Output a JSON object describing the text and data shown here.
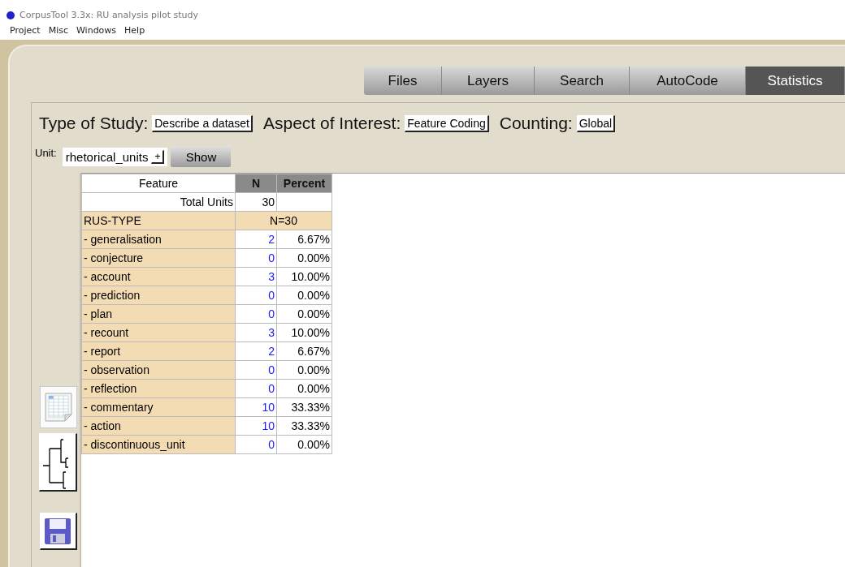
{
  "window": {
    "title": "CorpusTool 3.3x: RU analysis pilot study"
  },
  "menu": [
    "Project",
    "Misc",
    "Windows",
    "Help"
  ],
  "tabs": [
    {
      "label": "Files",
      "selected": false
    },
    {
      "label": "Layers",
      "selected": false
    },
    {
      "label": "Search",
      "selected": false
    },
    {
      "label": "AutoCode",
      "selected": false
    },
    {
      "label": "Statistics",
      "selected": true
    }
  ],
  "study": [
    {
      "label": "Type of Study:",
      "value": "Describe a dataset"
    },
    {
      "label": "Aspect of Interest:",
      "value": "Feature Coding"
    },
    {
      "label": "Counting:",
      "value": "Global"
    }
  ],
  "unit": {
    "label": "Unit:",
    "value": "rhetorical_units",
    "add": "+",
    "button": "Show"
  },
  "table": {
    "columns": [
      "Feature",
      "N",
      "Percent"
    ],
    "total": {
      "label": "Total Units",
      "n": "30"
    },
    "group": {
      "label": "RUS-TYPE",
      "n": "N=30"
    },
    "rows": [
      {
        "feature": "- generalisation",
        "n": "2",
        "percent": "6.67%"
      },
      {
        "feature": "- conjecture",
        "n": "0",
        "percent": "0.00%"
      },
      {
        "feature": "- account",
        "n": "3",
        "percent": "10.00%"
      },
      {
        "feature": "- prediction",
        "n": "0",
        "percent": "0.00%"
      },
      {
        "feature": "- plan",
        "n": "0",
        "percent": "0.00%"
      },
      {
        "feature": "- recount",
        "n": "3",
        "percent": "10.00%"
      },
      {
        "feature": "- report",
        "n": "2",
        "percent": "6.67%"
      },
      {
        "feature": "- observation",
        "n": "0",
        "percent": "0.00%"
      },
      {
        "feature": "- reflection",
        "n": "0",
        "percent": "0.00%"
      },
      {
        "feature": "- commentary",
        "n": "10",
        "percent": "33.33%"
      },
      {
        "feature": "- action",
        "n": "10",
        "percent": "33.33%"
      },
      {
        "feature": "- discontinuous_unit",
        "n": "0",
        "percent": "0.00%"
      }
    ]
  }
}
